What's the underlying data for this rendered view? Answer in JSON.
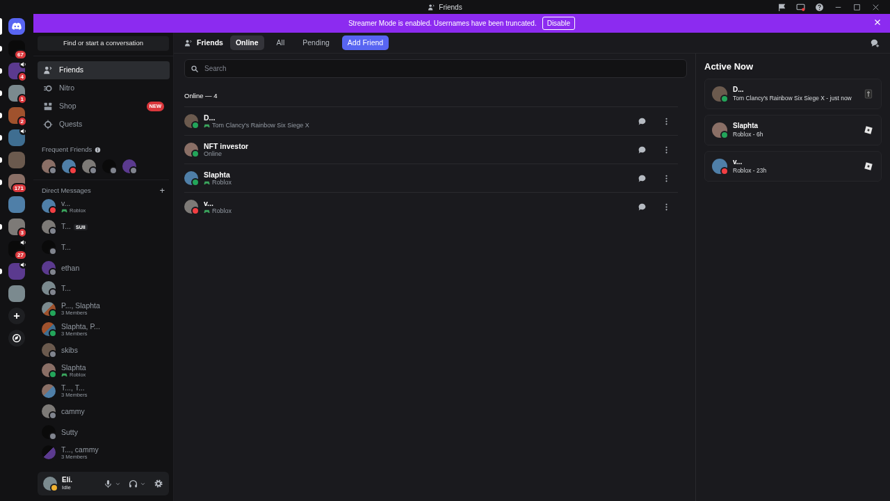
{
  "window": {
    "title": "Friends"
  },
  "banner": {
    "text": "Streamer Mode is enabled. Usernames have been truncated.",
    "button": "Disable"
  },
  "servers": [
    {
      "kind": "home",
      "selected": true
    },
    {
      "kind": "server",
      "badge": "67",
      "unread": true,
      "voice": false
    },
    {
      "kind": "server",
      "badge": "4",
      "unread": true,
      "voice": true
    },
    {
      "kind": "server",
      "badge": "1",
      "unread": true,
      "voice": false
    },
    {
      "kind": "server",
      "badge": "2",
      "unread": true,
      "voice": false
    },
    {
      "kind": "server",
      "unread": true,
      "voice": true
    },
    {
      "kind": "server",
      "unread": true,
      "voice": false
    },
    {
      "kind": "server",
      "badge": "171",
      "unread": true,
      "voice": false
    },
    {
      "kind": "server",
      "unread": false,
      "voice": false
    },
    {
      "kind": "server",
      "badge": "3",
      "unread": true,
      "voice": false
    },
    {
      "kind": "server",
      "badge": "27",
      "unread": false,
      "voice": true
    },
    {
      "kind": "server",
      "unread": true,
      "voice": true
    },
    {
      "kind": "server",
      "unread": false,
      "voice": false
    },
    {
      "kind": "add"
    },
    {
      "kind": "explore"
    }
  ],
  "sidebar": {
    "search": "Find or start a conversation",
    "nav": [
      {
        "label": "Friends",
        "selected": true
      },
      {
        "label": "Nitro",
        "selected": false
      },
      {
        "label": "Shop",
        "selected": false,
        "badge": "NEW"
      },
      {
        "label": "Quests",
        "selected": false
      }
    ],
    "frequent_title": "Frequent Friends",
    "frequent": [
      {
        "color": "#80848e"
      },
      {
        "color": "#f23f43"
      },
      {
        "color": "#80848e"
      },
      {
        "color": "#80848e"
      },
      {
        "color": "#80848e"
      }
    ],
    "dm_title": "Direct Messages",
    "dm_add": "+",
    "dms": [
      {
        "kind": "dm",
        "name": "v...",
        "subtitle": "Roblox",
        "game": true,
        "color": "#f23f43"
      },
      {
        "kind": "dm",
        "name": "T...",
        "tag": "SUII",
        "color": "#80848e"
      },
      {
        "kind": "dm",
        "name": "T...",
        "color": "#80848e"
      },
      {
        "kind": "dm",
        "name": "ethan",
        "color": "#80848e"
      },
      {
        "kind": "dm",
        "name": "T...",
        "color": "#80848e"
      },
      {
        "kind": "group",
        "name": "P..., Slaphta",
        "subtitle": "3 Members",
        "game": false,
        "color": "#23a55a"
      },
      {
        "kind": "group",
        "name": "Slaphta, P...",
        "subtitle": "3 Members",
        "game": false,
        "color": "#23a55a"
      },
      {
        "kind": "dm",
        "name": "skibs",
        "color": "#80848e"
      },
      {
        "kind": "dm",
        "name": "Slaphta",
        "subtitle": "Roblox",
        "game": true,
        "color": "#23a55a"
      },
      {
        "kind": "group",
        "name": "T..., T...",
        "subtitle": "3 Members",
        "game": false
      },
      {
        "kind": "dm",
        "name": "cammy",
        "color": "#80848e"
      },
      {
        "kind": "dm",
        "name": "Sutty",
        "color": "#80848e"
      },
      {
        "kind": "group",
        "name": "T..., cammy",
        "subtitle": "3 Members",
        "game": false
      }
    ]
  },
  "user": {
    "name": "Eli.",
    "status_text": "Idle",
    "color": "#f0b232"
  },
  "friends_header": {
    "title": "Friends",
    "tabs": [
      {
        "label": "Online",
        "kind": "tab",
        "selected": true
      },
      {
        "label": "All",
        "kind": "tab",
        "selected": false
      },
      {
        "label": "Pending",
        "kind": "tab",
        "selected": false
      },
      {
        "label": "Add Friend",
        "kind": "button"
      }
    ]
  },
  "search": {
    "placeholder": "Search"
  },
  "list_title": "Online — 4",
  "friends": [
    {
      "name": "D...",
      "activity": "Tom Clancy's Rainbow Six Siege X",
      "game": true,
      "color": "#23a55a"
    },
    {
      "name": "NFT investor",
      "activity": "Online",
      "game": false,
      "color": "#23a55a"
    },
    {
      "name": "Slaphta",
      "activity": "Roblox",
      "game": true,
      "color": "#23a55a"
    },
    {
      "name": "v...",
      "activity": "Roblox",
      "game": true,
      "color": "#f23f43"
    }
  ],
  "active_now": {
    "title": "Active Now",
    "cards": [
      {
        "name": "D...",
        "activity": "Tom Clancy's Rainbow Six Siege X - just now",
        "color": "#23a55a",
        "kind": "siege"
      },
      {
        "name": "Slaphta",
        "activity": "Roblox - 6h",
        "color": "#23a55a",
        "kind": "roblox"
      },
      {
        "name": "v...",
        "activity": "Roblox - 23h",
        "color": "#f23f43",
        "kind": "roblox"
      }
    ]
  }
}
